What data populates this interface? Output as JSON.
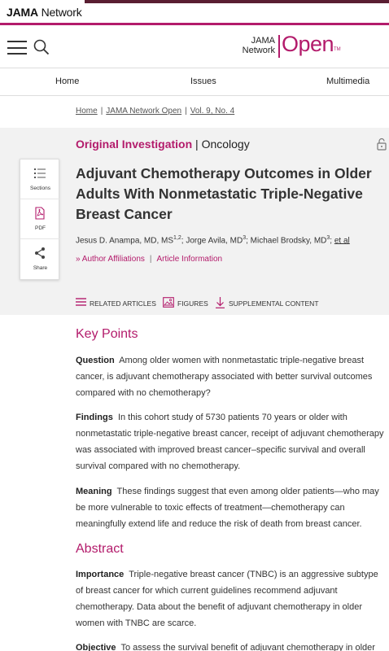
{
  "brand": {
    "name_bold": "JAMA",
    "name_rest": " Network"
  },
  "header": {
    "logo": {
      "line1": "JAMA",
      "line2": "Network",
      "open": "Open",
      "tm": "TM"
    }
  },
  "nav": {
    "items": [
      "Home",
      "Issues",
      "Multimedia"
    ]
  },
  "breadcrumb": {
    "items": [
      "Home",
      "JAMA Network Open",
      "Vol. 9, No. 4"
    ]
  },
  "article": {
    "type": "Original Investigation",
    "sep": " | ",
    "topic": "Oncology",
    "title": "Adjuvant Chemotherapy Outcomes in Older Adults With Nonmetastatic Triple-Negative Breast Cancer",
    "authors": [
      {
        "name": "Jesus D. Anampa, MD, MS",
        "sup": "1,2"
      },
      {
        "name": "Jorge Avila, MD",
        "sup": "3"
      },
      {
        "name": "Michael Brodsky, MD",
        "sup": "3"
      }
    ],
    "etal": "et al",
    "links": [
      "Author Affiliations",
      "Article Information"
    ]
  },
  "sidebox": {
    "items": [
      "Sections",
      "PDF",
      "Share"
    ]
  },
  "related": {
    "items": [
      "RELATED ARTICLES",
      "FIGURES",
      "SUPPLEMENTAL CONTENT"
    ]
  },
  "key_points": {
    "heading": "Key Points",
    "question_label": "Question",
    "question_text": "Among older women with nonmetastatic triple-negative breast cancer, is adjuvant chemotherapy associated with better survival outcomes compared with no chemotherapy?",
    "findings_label": "Findings",
    "findings_text": "In this cohort study of 5730 patients 70 years or older with nonmetastatic triple-negative breast cancer, receipt of adjuvant chemotherapy was associated with improved breast cancer–specific survival and overall survival compared with no chemotherapy.",
    "meaning_label": "Meaning",
    "meaning_text": "These findings suggest that even among older patients—who may be more vulnerable to toxic effects of treatment—chemotherapy can meaningfully extend life and reduce the risk of death from breast cancer."
  },
  "abstract": {
    "heading": "Abstract",
    "importance_label": "Importance",
    "importance_text": "Triple-negative breast cancer (TNBC) is an aggressive subtype of breast cancer for which current guidelines recommend adjuvant chemotherapy. Data about the benefit of adjuvant chemotherapy in older women with TNBC are scarce.",
    "objective_label": "Objective",
    "objective_text": "To assess the survival benefit of adjuvant chemotherapy in older"
  },
  "colors": {
    "accent": "#b31b6b",
    "panel": "#f2f2f2",
    "darkbar": "#5a1e32"
  }
}
